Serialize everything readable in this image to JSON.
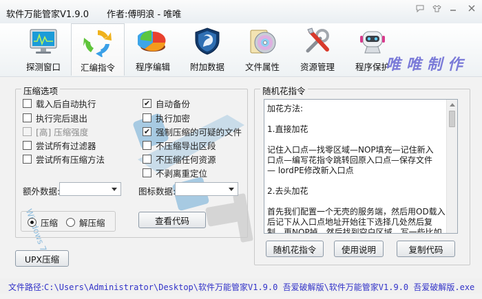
{
  "window": {
    "title": "软件万能管家V1.9.0",
    "author": "作者:傅明浪 - 唯唯"
  },
  "toolbar": {
    "items": [
      {
        "label": "探测窗口",
        "icon": "monitor-icon"
      },
      {
        "label": "汇编指令",
        "icon": "recycle-arrows-icon"
      },
      {
        "label": "程序编辑",
        "icon": "pie-chart-icon"
      },
      {
        "label": "附加数据",
        "icon": "shield-icon"
      },
      {
        "label": "文件属性",
        "icon": "disc-icon"
      },
      {
        "label": "资源管理",
        "icon": "tools-icon"
      },
      {
        "label": "程序保护",
        "icon": "robot-icon"
      }
    ],
    "active_index": 1,
    "brand": "唯唯制作"
  },
  "compress": {
    "title": "压缩选项",
    "left_options": [
      {
        "label": "载入后自动执行",
        "checked": false,
        "enabled": true
      },
      {
        "label": "执行完后退出",
        "checked": false,
        "enabled": true
      },
      {
        "label": "[高] 压缩强度",
        "checked": false,
        "enabled": false
      },
      {
        "label": "尝试所有过滤器",
        "checked": false,
        "enabled": true
      },
      {
        "label": "尝试所有压缩方法",
        "checked": false,
        "enabled": true
      }
    ],
    "right_options": [
      {
        "label": "自动备份",
        "checked": true
      },
      {
        "label": "执行加密",
        "checked": false
      },
      {
        "label": "强制压缩的可疑的文件",
        "checked": true
      },
      {
        "label": "不压缩导出区段",
        "checked": false
      },
      {
        "label": "不压缩任何资源",
        "checked": false
      },
      {
        "label": "不剥离重定位",
        "checked": false
      }
    ],
    "extra_data_label": "额外数据:",
    "extra_data_value": "",
    "icon_data_label": "图标数据:",
    "icon_data_value": "",
    "radio_compress": "压缩",
    "radio_decompress": "解压缩",
    "selected_mode": "compress",
    "view_code_button": "查看代码",
    "upx_button": "UPX压缩"
  },
  "junk": {
    "title": "随机花指令",
    "lines": [
      "加花方法:",
      "",
      "1.直接加花",
      "",
      "记住入口点—找零区域—NOP填充—记住新入",
      "口点—编写花指令跳转回原入口点—保存文件",
      "— lordPE修改新入口点",
      "",
      "2.去头加花",
      "",
      "首先我们配置一个无壳的服务端，然后用OD载入",
      "后记下从入口点地址开始往下选择几处然后复",
      "制，再NOP掉，然后找到空白区域，写一些比如"
    ],
    "buttons": [
      "随机花指令",
      "使用说明",
      "复制代码"
    ]
  },
  "status": {
    "path_label": "文件路径:",
    "path_value": "C:\\Users\\Administrator\\Desktop\\软件万能管家V1.9.0  吾爱破解版\\软件万能管家V1.9.0  吾爱破解版.exe"
  },
  "watermark": {
    "text": "Windows 7 Pro"
  },
  "colors": {
    "status_text": "#3232c8",
    "brand_text": "#7b7bd8",
    "watermark": "#6aaad6"
  }
}
